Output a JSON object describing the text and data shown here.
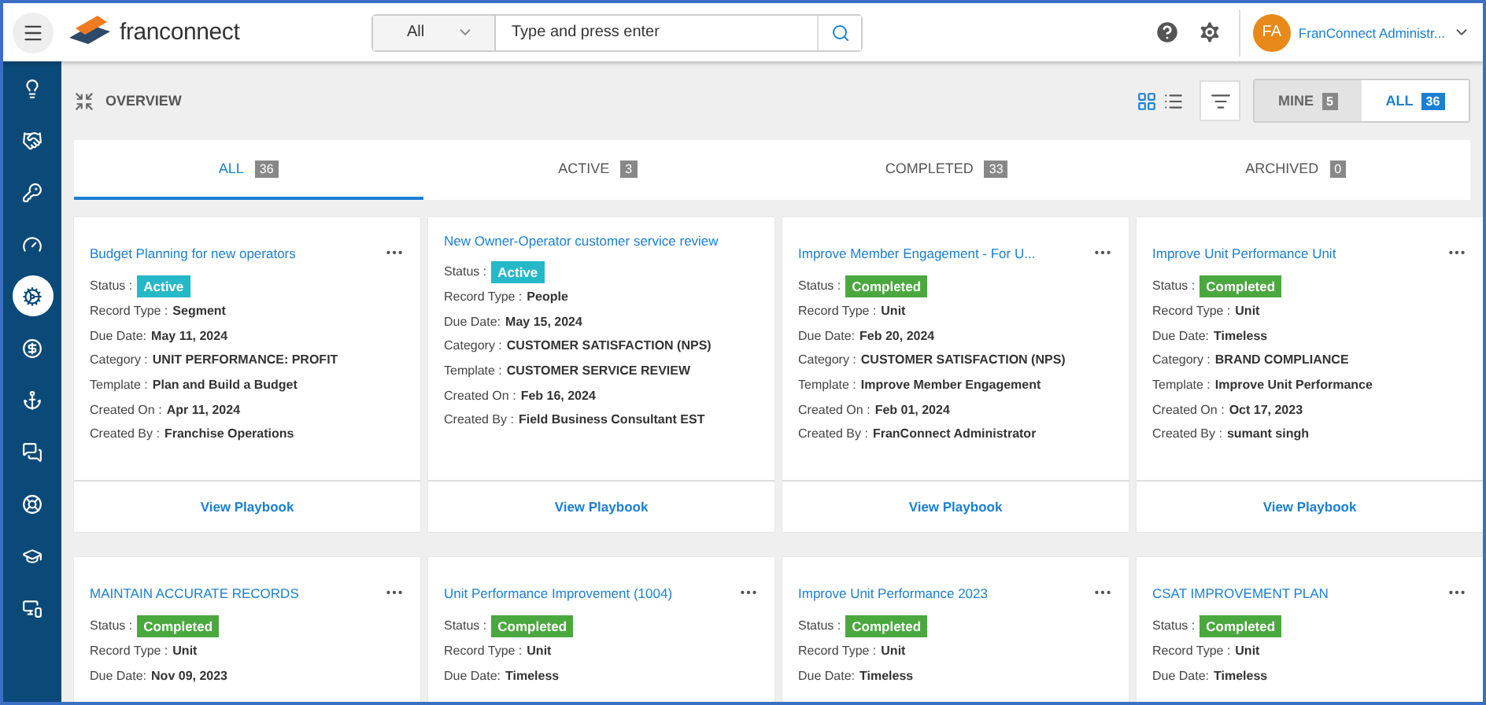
{
  "header": {
    "logo": "franconnect",
    "search": {
      "scope": "All",
      "placeholder": "Type and press enter"
    },
    "user": {
      "initials": "FA",
      "name": "FranConnect Administr..."
    }
  },
  "sidebar": {
    "items": [
      {
        "selected": false
      },
      {
        "selected": false
      },
      {
        "selected": false
      },
      {
        "selected": false
      },
      {
        "selected": true
      },
      {
        "selected": false
      },
      {
        "selected": false
      },
      {
        "selected": false
      },
      {
        "selected": false
      },
      {
        "selected": false
      },
      {
        "selected": false
      }
    ]
  },
  "toolbar": {
    "title": "OVERVIEW",
    "views": [
      {
        "selected": true
      },
      {
        "selected": false
      }
    ],
    "owner_toggle": [
      {
        "label": "MINE",
        "count": "5",
        "selected": false
      },
      {
        "label": "ALL",
        "count": "36",
        "selected": true
      }
    ]
  },
  "tabs": [
    {
      "label": "ALL",
      "count": "36",
      "selected": true
    },
    {
      "label": "ACTIVE",
      "count": "3",
      "selected": false
    },
    {
      "label": "COMPLETED",
      "count": "33",
      "selected": false
    },
    {
      "label": "ARCHIVED",
      "count": "0",
      "selected": false
    }
  ],
  "cards": [
    {
      "title": "Budget Planning for new operators",
      "menu": true,
      "status_label": "Status :",
      "status": {
        "text": "Active",
        "kind": "active"
      },
      "fields": [
        {
          "label": "Record Type :",
          "value": "Segment"
        },
        {
          "label": "Due Date:",
          "value": "May 11, 2024"
        },
        {
          "label": "Category :",
          "value": "UNIT PERFORMANCE: PROFIT"
        },
        {
          "label": "Template :",
          "value": "Plan and Build a Budget"
        },
        {
          "label": "Created On :",
          "value": "Apr 11, 2024"
        },
        {
          "label": "Created By :",
          "value": "Franchise Operations"
        }
      ],
      "action": "View Playbook"
    },
    {
      "title": "New Owner-Operator customer service review",
      "menu": false,
      "status_label": "Status :",
      "status": {
        "text": "Active",
        "kind": "active"
      },
      "fields": [
        {
          "label": "Record Type :",
          "value": "People"
        },
        {
          "label": "Due Date:",
          "value": "May 15, 2024"
        },
        {
          "label": "Category :",
          "value": "CUSTOMER SATISFACTION (NPS)"
        },
        {
          "label": "Template :",
          "value": "CUSTOMER SERVICE REVIEW"
        },
        {
          "label": "Created On :",
          "value": "Feb 16, 2024"
        },
        {
          "label": "Created By :",
          "value": "Field Business Consultant EST"
        }
      ],
      "action": "View Playbook"
    },
    {
      "title": "Improve Member Engagement - For U...",
      "menu": true,
      "status_label": "Status :",
      "status": {
        "text": "Completed",
        "kind": "completed"
      },
      "fields": [
        {
          "label": "Record Type :",
          "value": "Unit"
        },
        {
          "label": "Due Date:",
          "value": "Feb 20, 2024"
        },
        {
          "label": "Category :",
          "value": "CUSTOMER SATISFACTION (NPS)"
        },
        {
          "label": "Template :",
          "value": "Improve Member Engagement"
        },
        {
          "label": "Created On :",
          "value": "Feb 01, 2024"
        },
        {
          "label": "Created By :",
          "value": "FranConnect Administrator"
        }
      ],
      "action": "View Playbook"
    },
    {
      "title": "Improve Unit Performance Unit",
      "menu": true,
      "status_label": "Status :",
      "status": {
        "text": "Completed",
        "kind": "completed"
      },
      "fields": [
        {
          "label": "Record Type :",
          "value": "Unit"
        },
        {
          "label": "Due Date:",
          "value": "Timeless"
        },
        {
          "label": "Category :",
          "value": "BRAND COMPLIANCE"
        },
        {
          "label": "Template :",
          "value": "Improve Unit Performance"
        },
        {
          "label": "Created On :",
          "value": "Oct 17, 2023"
        },
        {
          "label": "Created By :",
          "value": "sumant singh"
        }
      ],
      "action": "View Playbook"
    },
    {
      "title": "MAINTAIN ACCURATE RECORDS",
      "menu": true,
      "status_label": "Status :",
      "status": {
        "text": "Completed",
        "kind": "completed"
      },
      "fields": [
        {
          "label": "Record Type :",
          "value": "Unit"
        },
        {
          "label": "Due Date:",
          "value": "Nov 09, 2023"
        }
      ]
    },
    {
      "title": "Unit Performance Improvement (1004)",
      "menu": true,
      "status_label": "Status :",
      "status": {
        "text": "Completed",
        "kind": "completed"
      },
      "fields": [
        {
          "label": "Record Type :",
          "value": "Unit"
        },
        {
          "label": "Due Date:",
          "value": "Timeless"
        }
      ]
    },
    {
      "title": "Improve Unit Performance 2023",
      "menu": true,
      "status_label": "Status :",
      "status": {
        "text": "Completed",
        "kind": "completed"
      },
      "fields": [
        {
          "label": "Record Type :",
          "value": "Unit"
        },
        {
          "label": "Due Date:",
          "value": "Timeless"
        }
      ]
    },
    {
      "title": "CSAT IMPROVEMENT PLAN",
      "menu": true,
      "status_label": "Status :",
      "status": {
        "text": "Completed",
        "kind": "completed"
      },
      "fields": [
        {
          "label": "Record Type :",
          "value": "Unit"
        },
        {
          "label": "Due Date:",
          "value": "Timeless"
        }
      ]
    }
  ]
}
